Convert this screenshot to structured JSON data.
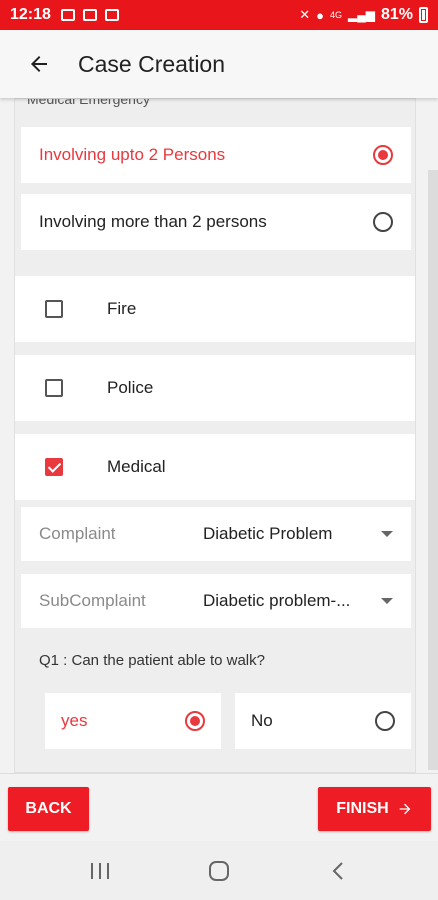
{
  "status_bar": {
    "time": "12:18",
    "battery": "81%",
    "network": "4G"
  },
  "app_bar": {
    "title": "Case Creation"
  },
  "section": {
    "clipped_label": "Medical Emergency"
  },
  "severity_options": [
    {
      "label": "Involving upto 2 Persons",
      "selected": true
    },
    {
      "label": "Involving more than 2 persons",
      "selected": false
    }
  ],
  "services": [
    {
      "label": "Fire",
      "checked": false
    },
    {
      "label": "Police",
      "checked": false
    },
    {
      "label": "Medical",
      "checked": true
    }
  ],
  "complaint": {
    "label": "Complaint",
    "value": "Diabetic Problem"
  },
  "subcomplaint": {
    "label": "SubComplaint",
    "value": "Diabetic problem-..."
  },
  "question": {
    "text": "Q1 : Can the patient able to walk?"
  },
  "answers": [
    {
      "label": "yes",
      "selected": true
    },
    {
      "label": "No",
      "selected": false
    }
  ],
  "footer": {
    "back_label": "BACK",
    "finish_label": "FINISH"
  },
  "colors": {
    "accent": "#e8393f",
    "status_bar": "#e8151b",
    "button": "#ee1c25"
  }
}
